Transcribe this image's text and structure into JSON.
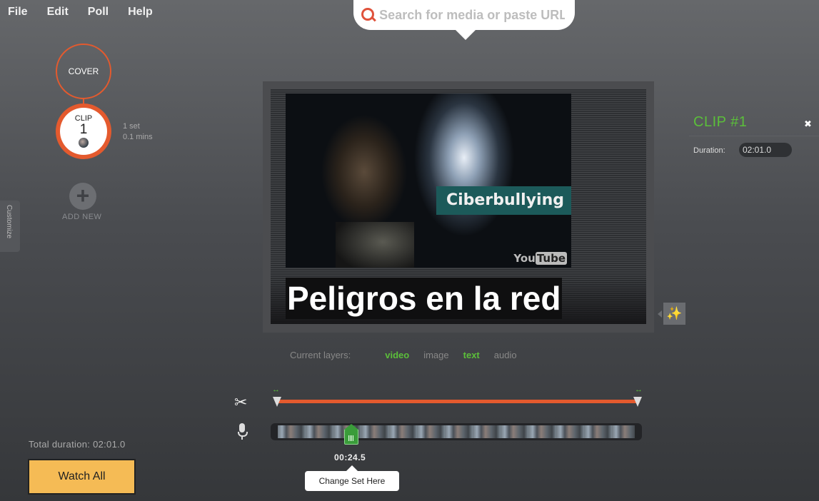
{
  "menu": [
    "File",
    "Edit",
    "Poll",
    "Help"
  ],
  "search": {
    "placeholder": "Search for media or paste URL"
  },
  "timeline_nav": {
    "cover_label": "COVER",
    "clip": {
      "label": "CLIP",
      "number": "1",
      "sets": "1 set",
      "length": "0.1 mins"
    },
    "add_new_label": "ADD NEW",
    "customize_label": "Customize"
  },
  "stage": {
    "video_caption": "Ciberbullying",
    "youtube_logo": {
      "you": "You",
      "tube": "Tube"
    },
    "title_text": "Peligros en la red"
  },
  "layers": {
    "label": "Current layers:",
    "items": [
      {
        "name": "video",
        "active": true
      },
      {
        "name": "image",
        "active": false
      },
      {
        "name": "text",
        "active": true
      },
      {
        "name": "audio",
        "active": false
      }
    ]
  },
  "clip_panel": {
    "title": "CLIP #1",
    "duration_label": "Duration:",
    "duration_value": "02:01.0",
    "close_label": "✖"
  },
  "editor": {
    "playhead_time": "00:24.5",
    "change_set_label": "Change Set Here",
    "trim_start_arrow": "↔",
    "trim_end_arrow": "↔"
  },
  "footer": {
    "total_duration": "Total duration: 02:01.0",
    "watch_all_label": "Watch All"
  },
  "colors": {
    "accent": "#e45a2e",
    "active_layer": "#5bbf3a",
    "watch_button": "#f5bb55"
  }
}
